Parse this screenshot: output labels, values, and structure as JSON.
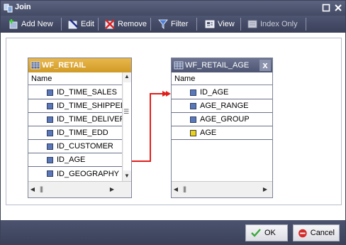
{
  "window": {
    "title": "Join"
  },
  "toolbar": {
    "add_new": "Add New",
    "edit": "Edit",
    "remove": "Remove",
    "filter": "Filter",
    "view": "View",
    "index_only": "Index Only"
  },
  "left_table": {
    "title": "WF_RETAIL",
    "column_header": "Name",
    "fields": [
      "ID_TIME_SALES",
      "ID_TIME_SHIPPED",
      "ID_TIME_DELIVER",
      "ID_TIME_EDD",
      "ID_CUSTOMER",
      "ID_AGE",
      "ID_GEOGRAPHY"
    ]
  },
  "right_table": {
    "title": "WF_RETAIL_AGE",
    "close_label": "x",
    "column_header": "Name",
    "fields": [
      "ID_AGE",
      "AGE_RANGE",
      "AGE_GROUP",
      "AGE"
    ]
  },
  "buttons": {
    "ok": "OK",
    "cancel": "Cancel"
  },
  "colors": {
    "accent_titlebar": "#4a516d",
    "left_header": "#d9a532",
    "join_line": "#e0201c"
  }
}
